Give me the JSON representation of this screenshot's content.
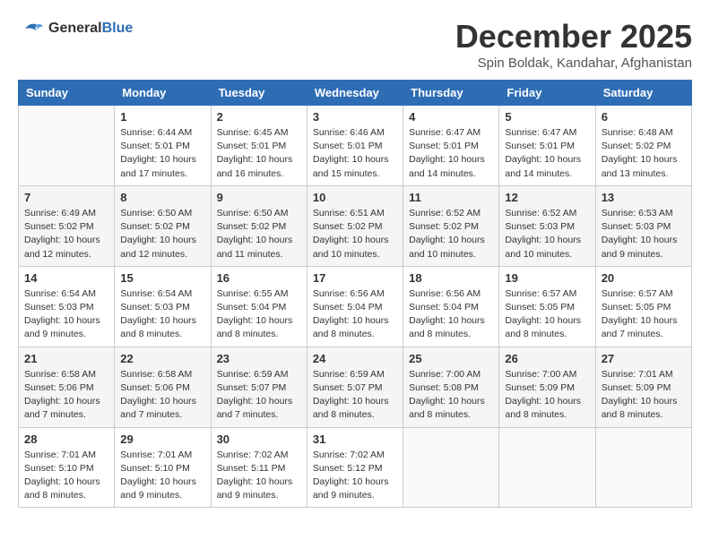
{
  "header": {
    "logo_line1": "General",
    "logo_line2": "Blue",
    "month_title": "December 2025",
    "subtitle": "Spin Boldak, Kandahar, Afghanistan"
  },
  "days_of_week": [
    "Sunday",
    "Monday",
    "Tuesday",
    "Wednesday",
    "Thursday",
    "Friday",
    "Saturday"
  ],
  "weeks": [
    [
      {
        "num": "",
        "info": ""
      },
      {
        "num": "1",
        "info": "Sunrise: 6:44 AM\nSunset: 5:01 PM\nDaylight: 10 hours\nand 17 minutes."
      },
      {
        "num": "2",
        "info": "Sunrise: 6:45 AM\nSunset: 5:01 PM\nDaylight: 10 hours\nand 16 minutes."
      },
      {
        "num": "3",
        "info": "Sunrise: 6:46 AM\nSunset: 5:01 PM\nDaylight: 10 hours\nand 15 minutes."
      },
      {
        "num": "4",
        "info": "Sunrise: 6:47 AM\nSunset: 5:01 PM\nDaylight: 10 hours\nand 14 minutes."
      },
      {
        "num": "5",
        "info": "Sunrise: 6:47 AM\nSunset: 5:01 PM\nDaylight: 10 hours\nand 14 minutes."
      },
      {
        "num": "6",
        "info": "Sunrise: 6:48 AM\nSunset: 5:02 PM\nDaylight: 10 hours\nand 13 minutes."
      }
    ],
    [
      {
        "num": "7",
        "info": "Sunrise: 6:49 AM\nSunset: 5:02 PM\nDaylight: 10 hours\nand 12 minutes."
      },
      {
        "num": "8",
        "info": "Sunrise: 6:50 AM\nSunset: 5:02 PM\nDaylight: 10 hours\nand 12 minutes."
      },
      {
        "num": "9",
        "info": "Sunrise: 6:50 AM\nSunset: 5:02 PM\nDaylight: 10 hours\nand 11 minutes."
      },
      {
        "num": "10",
        "info": "Sunrise: 6:51 AM\nSunset: 5:02 PM\nDaylight: 10 hours\nand 10 minutes."
      },
      {
        "num": "11",
        "info": "Sunrise: 6:52 AM\nSunset: 5:02 PM\nDaylight: 10 hours\nand 10 minutes."
      },
      {
        "num": "12",
        "info": "Sunrise: 6:52 AM\nSunset: 5:03 PM\nDaylight: 10 hours\nand 10 minutes."
      },
      {
        "num": "13",
        "info": "Sunrise: 6:53 AM\nSunset: 5:03 PM\nDaylight: 10 hours\nand 9 minutes."
      }
    ],
    [
      {
        "num": "14",
        "info": "Sunrise: 6:54 AM\nSunset: 5:03 PM\nDaylight: 10 hours\nand 9 minutes."
      },
      {
        "num": "15",
        "info": "Sunrise: 6:54 AM\nSunset: 5:03 PM\nDaylight: 10 hours\nand 8 minutes."
      },
      {
        "num": "16",
        "info": "Sunrise: 6:55 AM\nSunset: 5:04 PM\nDaylight: 10 hours\nand 8 minutes."
      },
      {
        "num": "17",
        "info": "Sunrise: 6:56 AM\nSunset: 5:04 PM\nDaylight: 10 hours\nand 8 minutes."
      },
      {
        "num": "18",
        "info": "Sunrise: 6:56 AM\nSunset: 5:04 PM\nDaylight: 10 hours\nand 8 minutes."
      },
      {
        "num": "19",
        "info": "Sunrise: 6:57 AM\nSunset: 5:05 PM\nDaylight: 10 hours\nand 8 minutes."
      },
      {
        "num": "20",
        "info": "Sunrise: 6:57 AM\nSunset: 5:05 PM\nDaylight: 10 hours\nand 7 minutes."
      }
    ],
    [
      {
        "num": "21",
        "info": "Sunrise: 6:58 AM\nSunset: 5:06 PM\nDaylight: 10 hours\nand 7 minutes."
      },
      {
        "num": "22",
        "info": "Sunrise: 6:58 AM\nSunset: 5:06 PM\nDaylight: 10 hours\nand 7 minutes."
      },
      {
        "num": "23",
        "info": "Sunrise: 6:59 AM\nSunset: 5:07 PM\nDaylight: 10 hours\nand 7 minutes."
      },
      {
        "num": "24",
        "info": "Sunrise: 6:59 AM\nSunset: 5:07 PM\nDaylight: 10 hours\nand 8 minutes."
      },
      {
        "num": "25",
        "info": "Sunrise: 7:00 AM\nSunset: 5:08 PM\nDaylight: 10 hours\nand 8 minutes."
      },
      {
        "num": "26",
        "info": "Sunrise: 7:00 AM\nSunset: 5:09 PM\nDaylight: 10 hours\nand 8 minutes."
      },
      {
        "num": "27",
        "info": "Sunrise: 7:01 AM\nSunset: 5:09 PM\nDaylight: 10 hours\nand 8 minutes."
      }
    ],
    [
      {
        "num": "28",
        "info": "Sunrise: 7:01 AM\nSunset: 5:10 PM\nDaylight: 10 hours\nand 8 minutes."
      },
      {
        "num": "29",
        "info": "Sunrise: 7:01 AM\nSunset: 5:10 PM\nDaylight: 10 hours\nand 9 minutes."
      },
      {
        "num": "30",
        "info": "Sunrise: 7:02 AM\nSunset: 5:11 PM\nDaylight: 10 hours\nand 9 minutes."
      },
      {
        "num": "31",
        "info": "Sunrise: 7:02 AM\nSunset: 5:12 PM\nDaylight: 10 hours\nand 9 minutes."
      },
      {
        "num": "",
        "info": ""
      },
      {
        "num": "",
        "info": ""
      },
      {
        "num": "",
        "info": ""
      }
    ]
  ]
}
